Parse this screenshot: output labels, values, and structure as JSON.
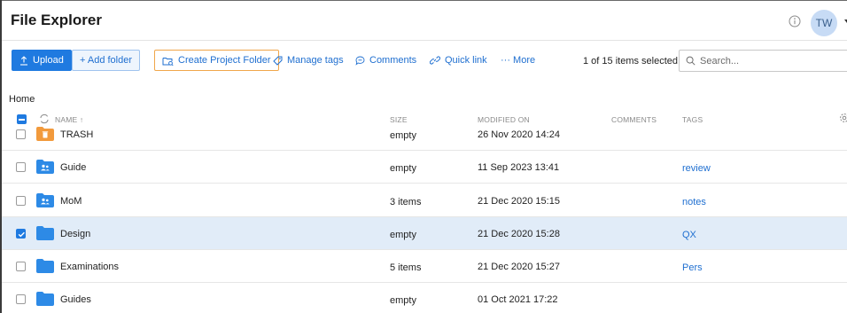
{
  "header": {
    "title": "File Explorer",
    "avatar_initials": "TW"
  },
  "toolbar": {
    "upload_label": "Upload",
    "add_folder_label": "+ Add folder",
    "create_project_label": "Create Project Folder",
    "manage_tags_label": "Manage tags",
    "comments_label": "Comments",
    "quick_link_label": "Quick link",
    "more_label": "··· More",
    "selection_text": "1 of 15 items selected",
    "search_placeholder": "Search..."
  },
  "breadcrumb": "Home",
  "table": {
    "columns": {
      "name": "NAME ↑",
      "size": "SIZE",
      "modified": "MODIFIED ON",
      "comments": "COMMENTS",
      "tags": "TAGS"
    },
    "rows": [
      {
        "name": "TRASH",
        "size": "empty",
        "modified": "26 Nov 2020 14:24",
        "tag": "",
        "icon": "trash-folder-icon",
        "selected": false
      },
      {
        "name": "Guide",
        "size": "empty",
        "modified": "11 Sep 2023 13:41",
        "tag": "review",
        "icon": "shared-folder-icon",
        "selected": false
      },
      {
        "name": "MoM",
        "size": "3 items",
        "modified": "21 Dec 2020 15:15",
        "tag": "notes",
        "icon": "shared-folder-icon",
        "selected": false
      },
      {
        "name": "Design",
        "size": "empty",
        "modified": "21 Dec 2020 15:28",
        "tag": "QX",
        "icon": "folder-icon",
        "selected": true
      },
      {
        "name": "Examinations",
        "size": "5 items",
        "modified": "21 Dec 2020 15:27",
        "tag": "Pers",
        "icon": "folder-icon",
        "selected": false
      },
      {
        "name": "Guides",
        "size": "empty",
        "modified": "01 Oct 2021 17:22",
        "tag": "",
        "icon": "folder-icon",
        "selected": false
      }
    ]
  },
  "colors": {
    "accent": "#1f7ae0",
    "selected_row": "#e1ecf8",
    "trash_folder": "#f29a3c",
    "folder": "#2d8ae6",
    "project_border": "#f0a64a"
  }
}
